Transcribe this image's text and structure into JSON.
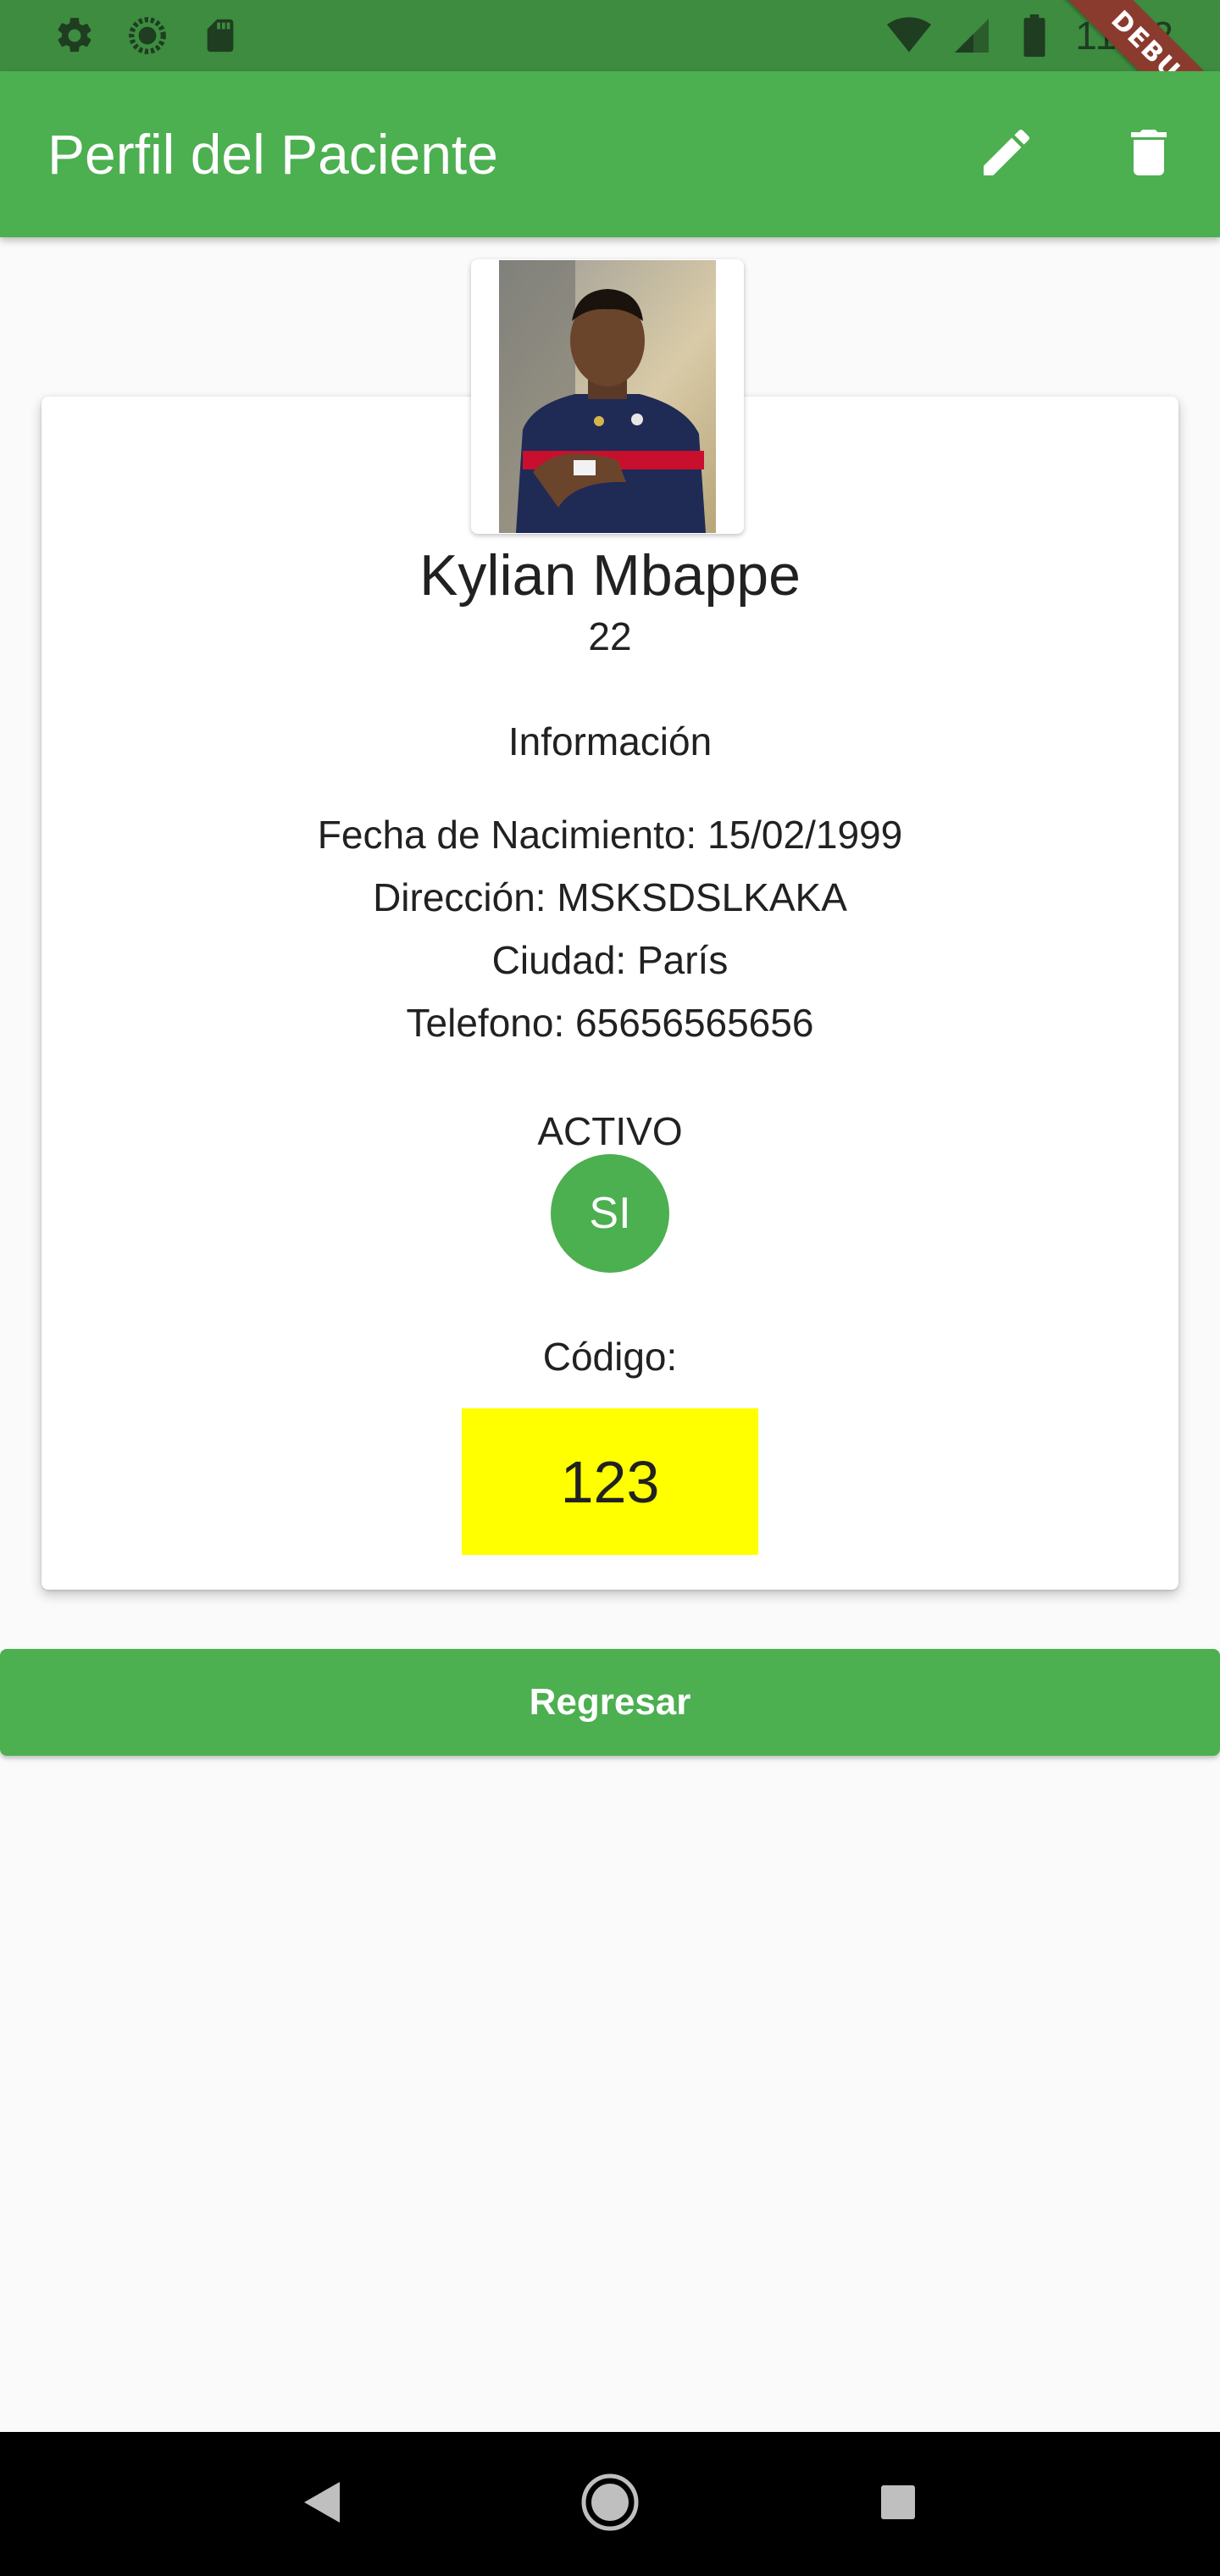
{
  "status_bar": {
    "time": "11:52",
    "icons": [
      "settings-icon",
      "sync-icon",
      "sd-card-icon",
      "wifi-icon",
      "signal-icon",
      "battery-icon"
    ],
    "debug_label": "DEBUG"
  },
  "app_bar": {
    "title": "Perfil del Paciente",
    "actions": [
      "edit-icon",
      "delete-icon"
    ]
  },
  "patient": {
    "name": "Kylian Mbappe",
    "age": "22",
    "info_title": "Información",
    "birth": "Fecha de Nacimiento: 15/02/1999",
    "address": "Dirección: MSKSDSLKAKA",
    "city": "Ciudad: París",
    "phone": "Telefono: 65656565656",
    "active_label": "ACTIVO",
    "active_value": "SI",
    "code_label": "Código:",
    "code_value": "123"
  },
  "button": {
    "back_label": "Regresar"
  },
  "nav_bar": {
    "buttons": [
      "back-icon",
      "home-icon",
      "recents-icon"
    ]
  },
  "colors": {
    "primary": "#4caf50",
    "status_bar": "#3d8c40",
    "code_highlight": "#ffff00",
    "debug_ribbon": "#8b3a2e"
  }
}
